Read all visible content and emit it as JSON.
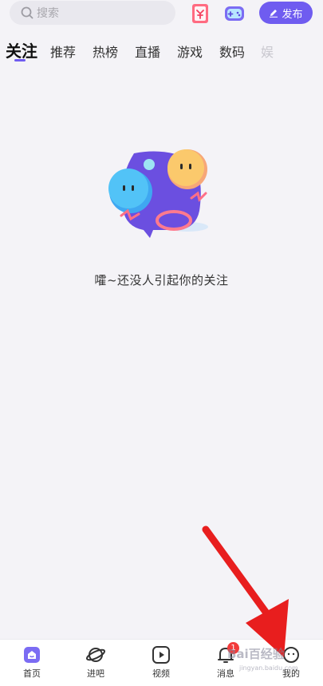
{
  "search": {
    "placeholder": "搜索"
  },
  "header": {
    "publish_label": "发布"
  },
  "tabs": [
    {
      "label": "关注",
      "active": true
    },
    {
      "label": "推荐"
    },
    {
      "label": "热榜"
    },
    {
      "label": "直播"
    },
    {
      "label": "游戏"
    },
    {
      "label": "数码"
    },
    {
      "label": "娱"
    }
  ],
  "empty_state": {
    "message": "嚯~还没人引起你的关注"
  },
  "bottom_nav": [
    {
      "label": "首页",
      "icon": "home-icon",
      "active": true
    },
    {
      "label": "进吧",
      "icon": "planet-icon"
    },
    {
      "label": "视频",
      "icon": "video-icon"
    },
    {
      "label": "消息",
      "icon": "bell-icon",
      "badge": "1"
    },
    {
      "label": "我的",
      "icon": "profile-icon"
    }
  ],
  "watermark": {
    "text": "Bai百经验",
    "url": "jingyan.baidu.com"
  },
  "colors": {
    "accent": "#6f5cf0",
    "badge": "#f23b3b",
    "arrow": "#e81e1e"
  }
}
